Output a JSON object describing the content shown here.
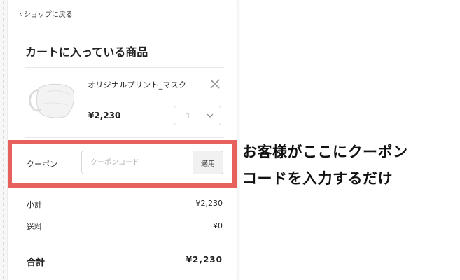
{
  "nav": {
    "back_label": "ショップに戻る"
  },
  "cart": {
    "title": "カートに入っている商品",
    "item": {
      "name": "オリジナルプリント_マスク",
      "price": "¥2,230",
      "quantity": "1",
      "image_icon": "face-mask-icon",
      "remove_icon": "close-icon"
    }
  },
  "coupon": {
    "label": "クーポン",
    "placeholder": "クーポンコード",
    "apply_label": "適用",
    "highlight_color": "#e8605c"
  },
  "summary": {
    "subtotal_label": "小計",
    "subtotal_value": "¥2,230",
    "shipping_label": "送料",
    "shipping_value": "¥0",
    "total_label": "合計",
    "total_value": "¥2,230"
  },
  "annotation": {
    "line1": "お客様がここにクーポン",
    "line2": "コードを入力するだけ"
  }
}
